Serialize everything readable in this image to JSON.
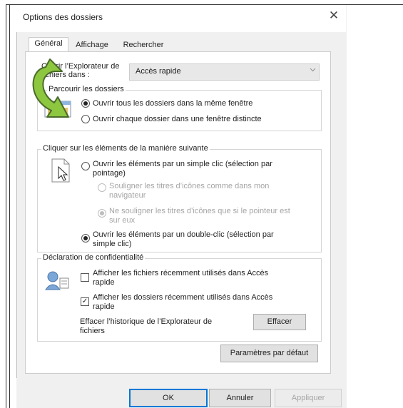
{
  "window": {
    "title": "Options des dossiers",
    "close_glyph": "✕"
  },
  "tabs": [
    "Général",
    "Affichage",
    "Rechercher"
  ],
  "open_explorer": {
    "label_line1": "Ouvrir l’Explorateur de",
    "label_line2": "fichiers dans :",
    "value": "Accès rapide"
  },
  "browse_folders": {
    "legend": "Parcourir les dossiers",
    "options": [
      "Ouvrir tous les dossiers dans la même fenêtre",
      "Ouvrir chaque dossier dans une fenêtre distincte"
    ]
  },
  "click_items": {
    "legend": "Cliquer sur les éléments de la manière suivante",
    "single_line1": "Ouvrir les éléments par un simple clic (sélection par",
    "single_line2": "pointage)",
    "underline_browser_line1": "Souligner les titres d’icônes comme dans mon",
    "underline_browser_line2": "navigateur",
    "underline_pointer_line1": "Ne souligner les titres d’icônes que si le pointeur est",
    "underline_pointer_line2": "sur eux",
    "double_line1": "Ouvrir les éléments par un double-clic (sélection par",
    "double_line2": "simple clic)"
  },
  "privacy": {
    "legend": "Déclaration de confidentialité",
    "recent_files_line1": "Afficher les fichiers récemment utilisés dans Accès",
    "recent_files_line2": "rapide",
    "recent_folders_line1": "Afficher les dossiers récemment utilisés dans Accès",
    "recent_folders_line2": "rapide",
    "clear_label_line1": "Effacer l’historique de l’Explorateur de",
    "clear_label_line2": "fichiers",
    "clear_button": "Effacer",
    "recent_folders_checked": true
  },
  "restore_defaults": "Paramètres par défaut",
  "buttons": {
    "ok": "OK",
    "cancel": "Annuler",
    "apply": "Appliquer"
  },
  "icons": [
    "chevron-down-icon",
    "folder-window-icon",
    "pointer-document-icon",
    "privacy-icon",
    "curved-arrow-icon"
  ],
  "colors": {
    "accent": "#0078d7",
    "arrow_fill": "#8dc63f",
    "arrow_stroke": "#4a6b2a"
  }
}
